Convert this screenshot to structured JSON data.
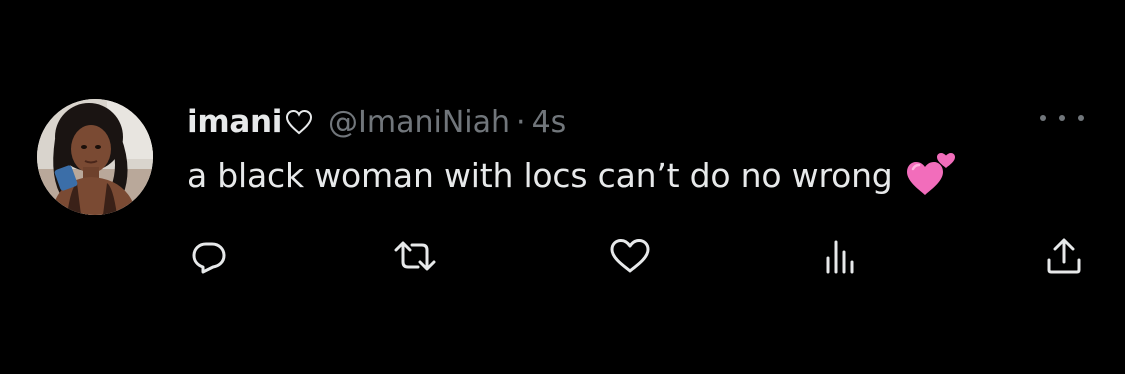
{
  "tweet": {
    "display_name": "imani",
    "name_heart_icon": "heart-outline-icon",
    "handle": "@ImaniNiah",
    "separator": "·",
    "time": "4s",
    "text": "a black woman with locs can’t do no wrong",
    "text_emoji": "two-hearts-emoji"
  },
  "actions": {
    "reply_icon": "reply-icon",
    "retweet_icon": "retweet-icon",
    "like_icon": "like-icon",
    "views_icon": "views-icon",
    "share_icon": "share-icon"
  },
  "colors": {
    "background": "#000000",
    "primary_text": "#e7e9ea",
    "secondary_text": "#71767b",
    "emoji_pink": "#f26dbb"
  }
}
